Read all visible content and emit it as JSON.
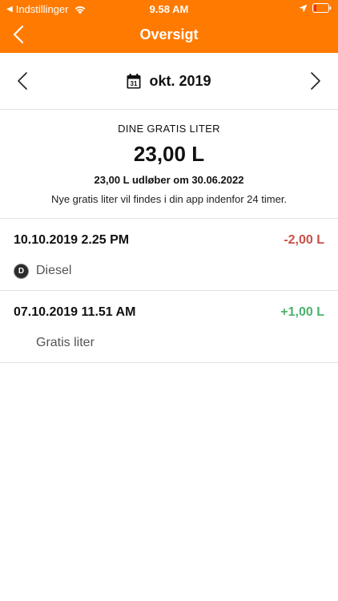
{
  "status_bar": {
    "back_app": "Indstillinger",
    "time": "9.58 AM"
  },
  "header": {
    "title": "Oversigt",
    "back_icon": "chevron-left-icon",
    "background_color": "#ff7a00"
  },
  "month_selector": {
    "calendar_day": "31",
    "label": "okt. 2019"
  },
  "summary": {
    "title": "DINE GRATIS LITER",
    "amount": "23,00 L",
    "expiry": "23,00 L udløber om 30.06.2022",
    "note": "Nye gratis liter vil findes i din app indenfor 24 timer."
  },
  "transactions": [
    {
      "datetime": "10.10.2019 2.25 PM",
      "amount": "-2,00 L",
      "amount_color": "#c85048",
      "product_icon_letter": "D",
      "product": "Diesel"
    },
    {
      "datetime": "07.10.2019 11.51 AM",
      "amount": "+1,00 L",
      "amount_color": "#4cb26b",
      "product": "Gratis liter"
    }
  ]
}
